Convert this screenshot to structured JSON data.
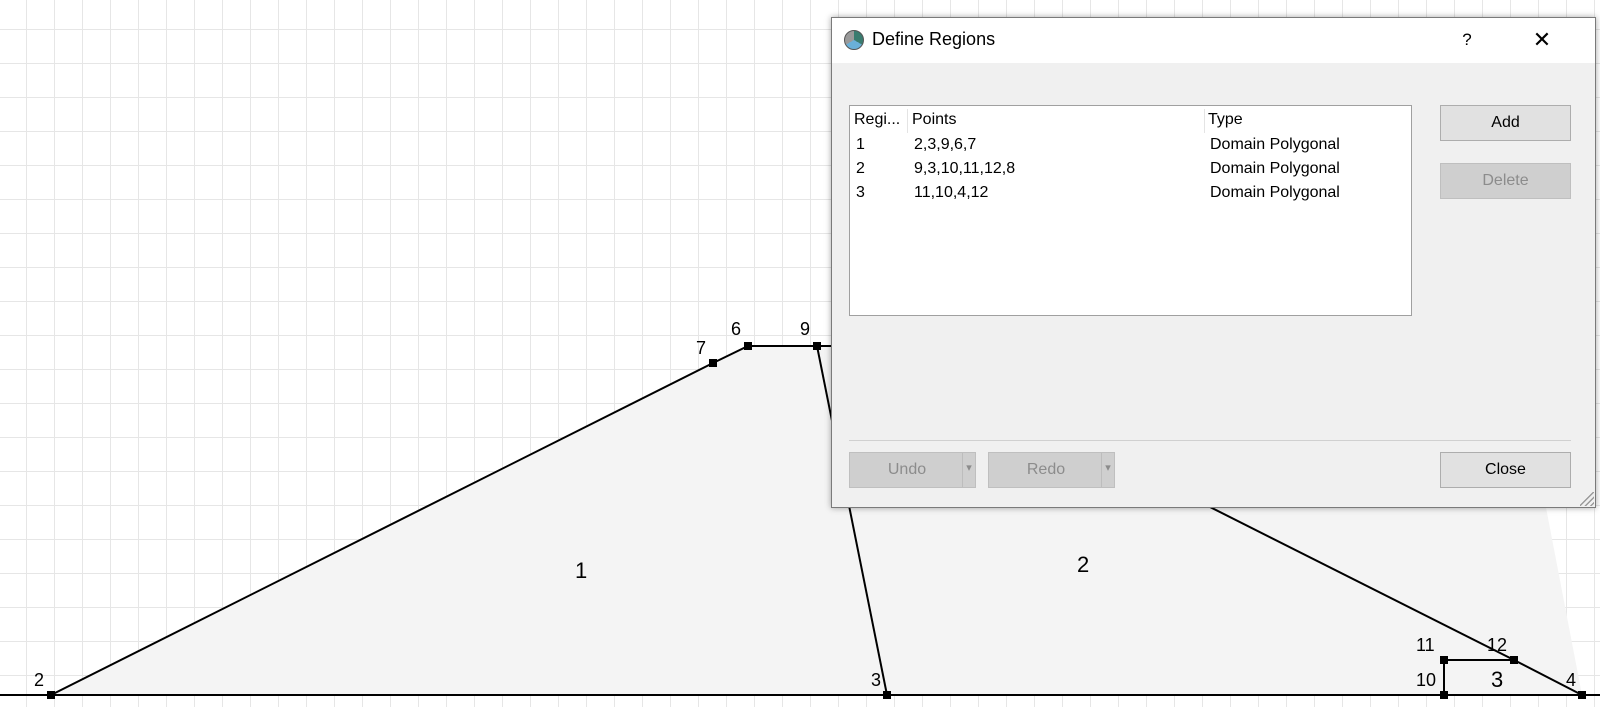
{
  "canvas": {
    "points": [
      {
        "id": "2",
        "label": "2"
      },
      {
        "id": "3",
        "label": "3"
      },
      {
        "id": "4",
        "label": "4"
      },
      {
        "id": "6",
        "label": "6"
      },
      {
        "id": "7",
        "label": "7"
      },
      {
        "id": "9",
        "label": "9"
      },
      {
        "id": "10",
        "label": "10"
      },
      {
        "id": "11",
        "label": "11"
      },
      {
        "id": "12",
        "label": "12"
      }
    ],
    "regions": [
      {
        "label": "1"
      },
      {
        "label": "2"
      },
      {
        "label": "3"
      }
    ]
  },
  "dialog": {
    "title": "Define Regions",
    "help_label": "?",
    "close_x_label": "✕",
    "table": {
      "headers": [
        "Regi...",
        "Points",
        "Type"
      ],
      "rows": [
        [
          "1",
          "2,3,9,6,7",
          "Domain Polygonal"
        ],
        [
          "2",
          "9,3,10,11,12,8",
          "Domain Polygonal"
        ],
        [
          "3",
          "11,10,4,12",
          "Domain Polygonal"
        ]
      ]
    },
    "add_label": "Add",
    "delete_label": "Delete",
    "undo_label": "Undo",
    "redo_label": "Redo",
    "dropdown_arrow": "▾",
    "close_label": "Close"
  }
}
